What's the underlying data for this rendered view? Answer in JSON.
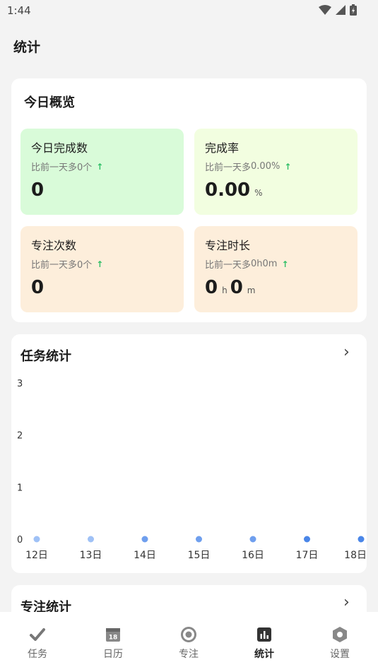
{
  "status_bar": {
    "time": "1:44"
  },
  "page": {
    "title": "统计"
  },
  "today_overview": {
    "title": "今日概览",
    "tiles": [
      {
        "label": "今日完成数",
        "compare_prefix": "比前一天多",
        "compare_value": "0个",
        "arrow": "↑",
        "value": "0",
        "color": "#d9fbd9"
      },
      {
        "label": "完成率",
        "compare_prefix": "比前一天多",
        "compare_value": "0.00%",
        "arrow": "↑",
        "value": "0.00",
        "unit": "%",
        "color": "#f2fee0"
      },
      {
        "label": "专注次数",
        "compare_prefix": "比前一天多",
        "compare_value": "0个",
        "arrow": "↑",
        "value": "0",
        "color": "#fdeedb"
      },
      {
        "label": "专注时长",
        "compare_prefix": "比前一天多",
        "compare_value": "0h0m",
        "arrow": "↑",
        "hours": "0",
        "hours_unit": "h",
        "minutes": "0",
        "minutes_unit": "m",
        "color": "#fdeedb"
      }
    ]
  },
  "task_stats": {
    "title": "任务统计"
  },
  "chart_data": {
    "type": "line",
    "categories": [
      "12日",
      "13日",
      "14日",
      "15日",
      "16日",
      "17日",
      "18日"
    ],
    "series": [
      {
        "values": [
          0,
          0,
          0,
          0,
          0,
          0,
          0
        ],
        "color": "#4a86e8"
      }
    ],
    "y_ticks": [
      "0",
      "1",
      "2",
      "3"
    ],
    "ylim": [
      0,
      3
    ],
    "grid": false
  },
  "focus_stats": {
    "title": "专注统计"
  },
  "bottom_nav": {
    "items": [
      {
        "label": "任务",
        "icon": "check-icon"
      },
      {
        "label": "日历",
        "icon": "calendar-icon",
        "day": "18"
      },
      {
        "label": "专注",
        "icon": "focus-circle-icon"
      },
      {
        "label": "统计",
        "icon": "chart-icon",
        "active": true
      },
      {
        "label": "设置",
        "icon": "hexagon-settings-icon"
      }
    ]
  }
}
